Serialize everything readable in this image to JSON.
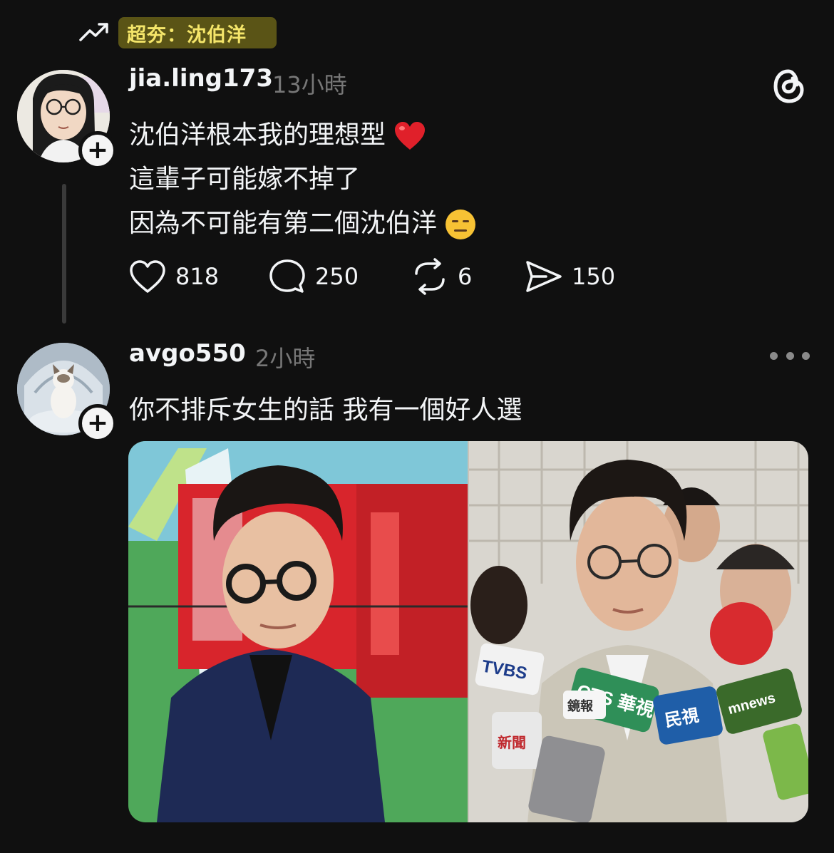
{
  "trending": {
    "icon": "trending-up-icon",
    "topic": "超夯：沈伯洋"
  },
  "post": {
    "username": "jia.ling173",
    "time": "13小時",
    "lines": [
      "沈伯洋根本我的理想型",
      "這輩子可能嫁不掉了",
      "因為不可能有第二個沈伯洋"
    ],
    "emojis": [
      "red-heart-emoji",
      "expressionless-face-emoji"
    ],
    "stats": {
      "likes": "818",
      "replies": "250",
      "reposts": "6",
      "shares": "150"
    }
  },
  "reply": {
    "username": "avgo550",
    "time": "2小時",
    "text": "你不排斥女生的話 我有一個好人選",
    "media_caption_marks": [
      "TVBS",
      "CTS 華視",
      "民視",
      "mnews",
      "鏡報",
      "新聞"
    ]
  },
  "colors": {
    "background": "#101010",
    "topic_highlight": "#5a5416",
    "topic_text": "#f5e66a",
    "muted": "#777777"
  }
}
